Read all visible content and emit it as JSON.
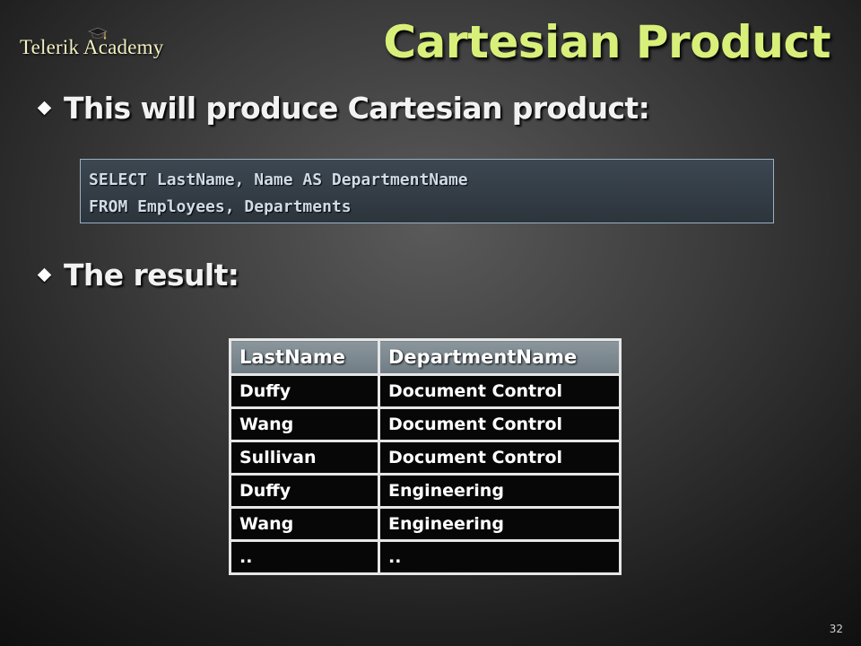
{
  "logo": {
    "text": "Telerik Academy"
  },
  "title": "Cartesian Product",
  "bullets": {
    "first": "This will produce Cartesian product:",
    "second": "The result:"
  },
  "code": {
    "lines": [
      "SELECT LastName, Name AS DepartmentName",
      "FROM Employees, Departments"
    ]
  },
  "table": {
    "headers": [
      "LastName",
      "DepartmentName"
    ],
    "rows": [
      [
        "Duffy",
        "Document Control"
      ],
      [
        "Wang",
        "Document Control"
      ],
      [
        "Sullivan",
        "Document Control"
      ],
      [
        "Duffy",
        "Engineering"
      ],
      [
        "Wang",
        "Engineering"
      ],
      [
        "..",
        ".."
      ]
    ]
  },
  "page_number": "32"
}
